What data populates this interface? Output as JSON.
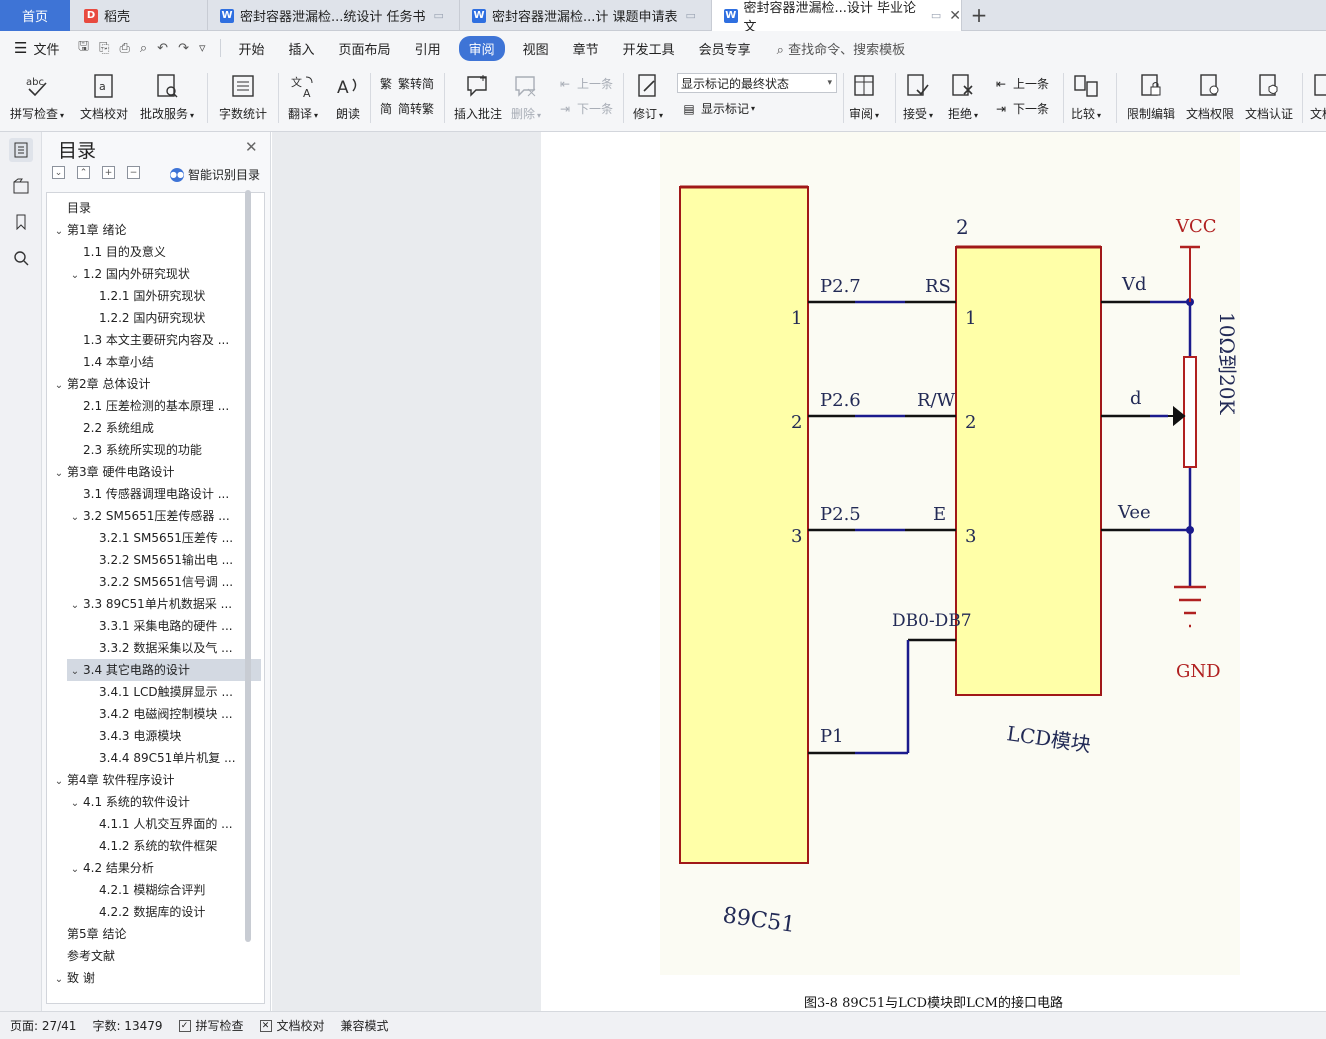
{
  "tabs": {
    "home": "首页",
    "items": [
      {
        "label": "稻壳",
        "icon": "daoke-icon"
      },
      {
        "label": "密封容器泄漏检...统设计 任务书",
        "icon": "word-icon"
      },
      {
        "label": "密封容器泄漏检...计 课题申请表",
        "icon": "word-icon"
      },
      {
        "label": "密封容器泄漏检...设计 毕业论文",
        "icon": "word-icon"
      }
    ],
    "new_tab": "+"
  },
  "menu": {
    "file": "文件",
    "items": [
      "开始",
      "插入",
      "页面布局",
      "引用",
      "审阅",
      "视图",
      "章节",
      "开发工具",
      "会员专享"
    ],
    "active": "审阅",
    "search": "查找命令、搜索模板"
  },
  "ribbon": {
    "spell_check": "拼写检查",
    "doc_proof": "文档校对",
    "batch_service": "批改服务",
    "word_count": "字数统计",
    "translate": "翻译",
    "read_aloud": "朗读",
    "to_traditional": "繁转简",
    "to_simplified": "简转繁",
    "insert_comment": "插入批注",
    "delete": "删除",
    "prev_comment": "上一条",
    "next_comment": "下一条",
    "track_changes": "修订",
    "markup_state": "显示标记的最终状态",
    "show_markup": "显示标记",
    "review_pane": "审阅",
    "accept": "接受",
    "reject": "拒绝",
    "prev_change": "上一条",
    "next_change": "下一条",
    "compare": "比较",
    "restrict_edit": "限制编辑",
    "doc_permission": "文档权限",
    "doc_cert": "文档认证",
    "doc_more": "文档"
  },
  "outline": {
    "title": "目录",
    "smart": "智能识别目录",
    "items": [
      {
        "text": "目录",
        "level": 0,
        "tw": ""
      },
      {
        "text": "第1章  绪论",
        "level": 0,
        "tw": "v"
      },
      {
        "text": "1.1  目的及意义",
        "level": 1,
        "tw": ""
      },
      {
        "text": "1.2  国内外研究现状",
        "level": 1,
        "tw": "v"
      },
      {
        "text": "1.2.1  国外研究现状",
        "level": 2,
        "tw": ""
      },
      {
        "text": "1.2.2  国内研究现状",
        "level": 2,
        "tw": ""
      },
      {
        "text": "1.3  本文主要研究内容及 ...",
        "level": 1,
        "tw": ""
      },
      {
        "text": "1.4  本章小结",
        "level": 1,
        "tw": ""
      },
      {
        "text": "第2章  总体设计",
        "level": 0,
        "tw": "v"
      },
      {
        "text": "2.1  压差检测的基本原理 ...",
        "level": 1,
        "tw": ""
      },
      {
        "text": "2.2  系统组成",
        "level": 1,
        "tw": ""
      },
      {
        "text": "2.3  系统所实现的功能",
        "level": 1,
        "tw": ""
      },
      {
        "text": "第3章  硬件电路设计",
        "level": 0,
        "tw": "v"
      },
      {
        "text": "3.1  传感器调理电路设计 ...",
        "level": 1,
        "tw": ""
      },
      {
        "text": "3.2 SM5651压差传感器 ...",
        "level": 1,
        "tw": "v"
      },
      {
        "text": "3.2.1 SM5651压差传 ...",
        "level": 2,
        "tw": ""
      },
      {
        "text": "3.2.2 SM5651输出电 ...",
        "level": 2,
        "tw": ""
      },
      {
        "text": "3.2.2 SM5651信号调 ...",
        "level": 2,
        "tw": ""
      },
      {
        "text": "3.3 89C51单片机数据采 ...",
        "level": 1,
        "tw": "v"
      },
      {
        "text": "3.3.1  采集电路的硬件 ...",
        "level": 2,
        "tw": ""
      },
      {
        "text": "3.3.2  数据采集以及气 ...",
        "level": 2,
        "tw": ""
      },
      {
        "text": "3.4  其它电路的设计",
        "level": 1,
        "tw": "v",
        "selected": true
      },
      {
        "text": "3.4.1 LCD触摸屏显示 ...",
        "level": 2,
        "tw": ""
      },
      {
        "text": "3.4.2  电磁阀控制模块 ...",
        "level": 2,
        "tw": ""
      },
      {
        "text": "3.4.3  电源模块",
        "level": 2,
        "tw": ""
      },
      {
        "text": "3.4.4 89C51单片机复 ...",
        "level": 2,
        "tw": ""
      },
      {
        "text": "第4章  软件程序设计",
        "level": 0,
        "tw": "v"
      },
      {
        "text": "4.1  系统的软件设计",
        "level": 1,
        "tw": "v"
      },
      {
        "text": "4.1.1  人机交互界面的 ...",
        "level": 2,
        "tw": ""
      },
      {
        "text": "4.1.2  系统的软件框架",
        "level": 2,
        "tw": ""
      },
      {
        "text": "4.2  结果分析",
        "level": 1,
        "tw": "v"
      },
      {
        "text": "4.2.1  模糊综合评判",
        "level": 2,
        "tw": ""
      },
      {
        "text": "4.2.2  数据库的设计",
        "level": 2,
        "tw": ""
      },
      {
        "text": "第5章  结论",
        "level": 0,
        "tw": ""
      },
      {
        "text": "参考文献",
        "level": 0,
        "tw": ""
      },
      {
        "text": "致    谢",
        "level": 0,
        "tw": "v"
      }
    ]
  },
  "figure": {
    "mcu_label": "89C51",
    "lcd_label": "LCD模块",
    "lcd_pin_number": "2",
    "mcu_pins": [
      {
        "num": "1",
        "port": "P2.7",
        "lcd_pin": "RS",
        "lcd_num": "1"
      },
      {
        "num": "2",
        "port": "P2.6",
        "lcd_pin": "R/W",
        "lcd_num": "2"
      },
      {
        "num": "3",
        "port": "P2.5",
        "lcd_pin": "E",
        "lcd_num": "3"
      }
    ],
    "p1": "P1",
    "data_bus": "DB0-DB7",
    "vd": "Vd",
    "d": "d",
    "vee": "Vee",
    "vcc": "VCC",
    "gnd": "GND",
    "pot": "10Ω到20K",
    "caption": "图3-8 89C51与LCD模块即LCM的接口电路"
  },
  "status": {
    "page": "页面: 27/41",
    "words": "字数: 13479",
    "spell": "拼写检查",
    "proof": "文档校对",
    "compat": "兼容模式"
  },
  "colors": {
    "accent": "#3e74d6",
    "chip_fill": "#ffffa8",
    "chip_border": "#a01818",
    "wire_blue": "#1a1a8c",
    "power_red": "#b02020"
  }
}
